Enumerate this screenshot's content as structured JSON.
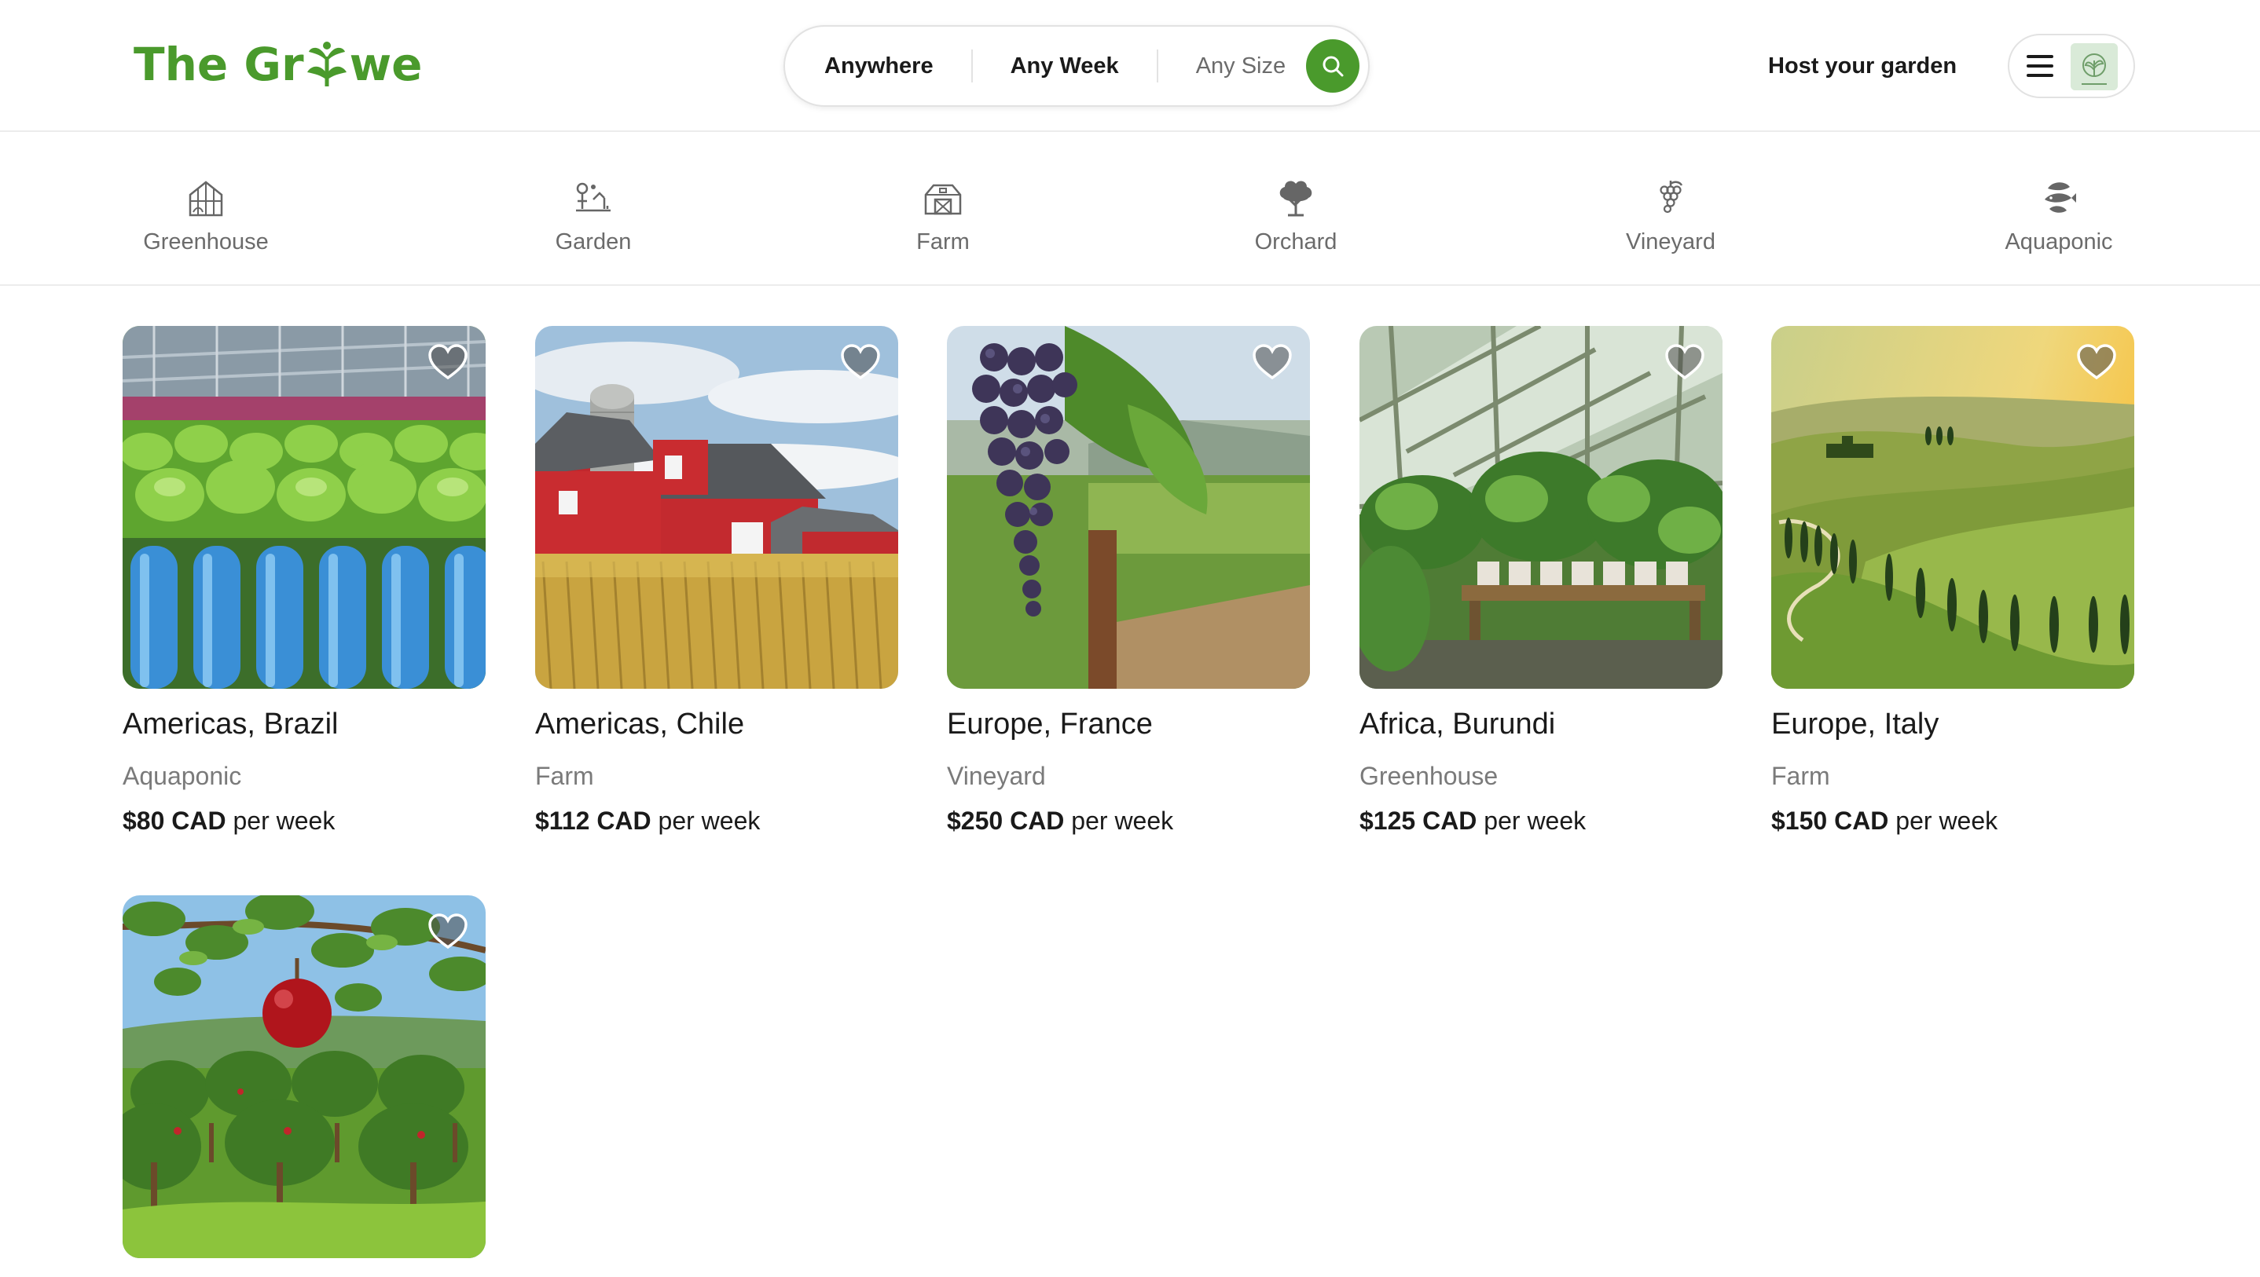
{
  "brand": {
    "logo_part1": "The Gr",
    "logo_part2": "we",
    "color": "#4a9a2c"
  },
  "search": {
    "location": "Anywhere",
    "week": "Any Week",
    "size": "Any Size",
    "icon": "search-icon"
  },
  "header": {
    "host_label": "Host your garden",
    "menu_icon": "hamburger-icon",
    "avatar_icon": "user-avatar"
  },
  "categories": [
    {
      "label": "Greenhouse",
      "icon": "greenhouse-icon"
    },
    {
      "label": "Garden",
      "icon": "garden-icon"
    },
    {
      "label": "Farm",
      "icon": "barn-icon"
    },
    {
      "label": "Orchard",
      "icon": "tree-icon"
    },
    {
      "label": "Vineyard",
      "icon": "grapes-icon"
    },
    {
      "label": "Aquaponic",
      "icon": "fish-plant-icon"
    }
  ],
  "listings": [
    {
      "location": "Americas, Brazil",
      "type": "Aquaponic",
      "price": "$80 CAD",
      "per": "per week",
      "image": "hydroponic lettuce rows with blue pipes"
    },
    {
      "location": "Americas, Chile",
      "type": "Farm",
      "price": "$112 CAD",
      "per": "per week",
      "image": "red barn and silo over wheat field"
    },
    {
      "location": "Europe, France",
      "type": "Vineyard",
      "price": "$250 CAD",
      "per": "per week",
      "image": "purple grape cluster in vineyard"
    },
    {
      "location": "Africa, Burundi",
      "type": "Greenhouse",
      "price": "$125 CAD",
      "per": "per week",
      "image": "glass greenhouse with potted plants"
    },
    {
      "location": "Europe, Italy",
      "type": "Farm",
      "price": "$150 CAD",
      "per": "per week",
      "image": "rolling green hills with cypress trees"
    },
    {
      "location": "",
      "type": "",
      "price": "",
      "per": "",
      "image": "red apple on orchard branch"
    }
  ],
  "icons": {
    "favorite": "heart-icon"
  }
}
